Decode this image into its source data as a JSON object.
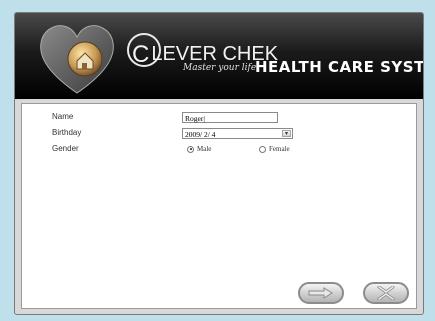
{
  "brand": {
    "logo_text": "LEVER CHEK",
    "logo_initial": "C",
    "tagline": "Master your life.",
    "title": "HEALTH CARE SYSTEM"
  },
  "form": {
    "name_label": "Name",
    "name_value": "Roger|",
    "birthday_label": "Birthday",
    "birthday_value": "2009/ 2/ 4",
    "gender_label": "Gender",
    "gender_options": [
      "Male",
      "Female"
    ],
    "gender_selected": "Male"
  },
  "buttons": {
    "next_icon": "arrow-right-icon",
    "cancel_icon": "x-icon"
  },
  "colors": {
    "background": "#bfe0ea",
    "header": "#000000",
    "button_face": "#cfcfcf"
  }
}
